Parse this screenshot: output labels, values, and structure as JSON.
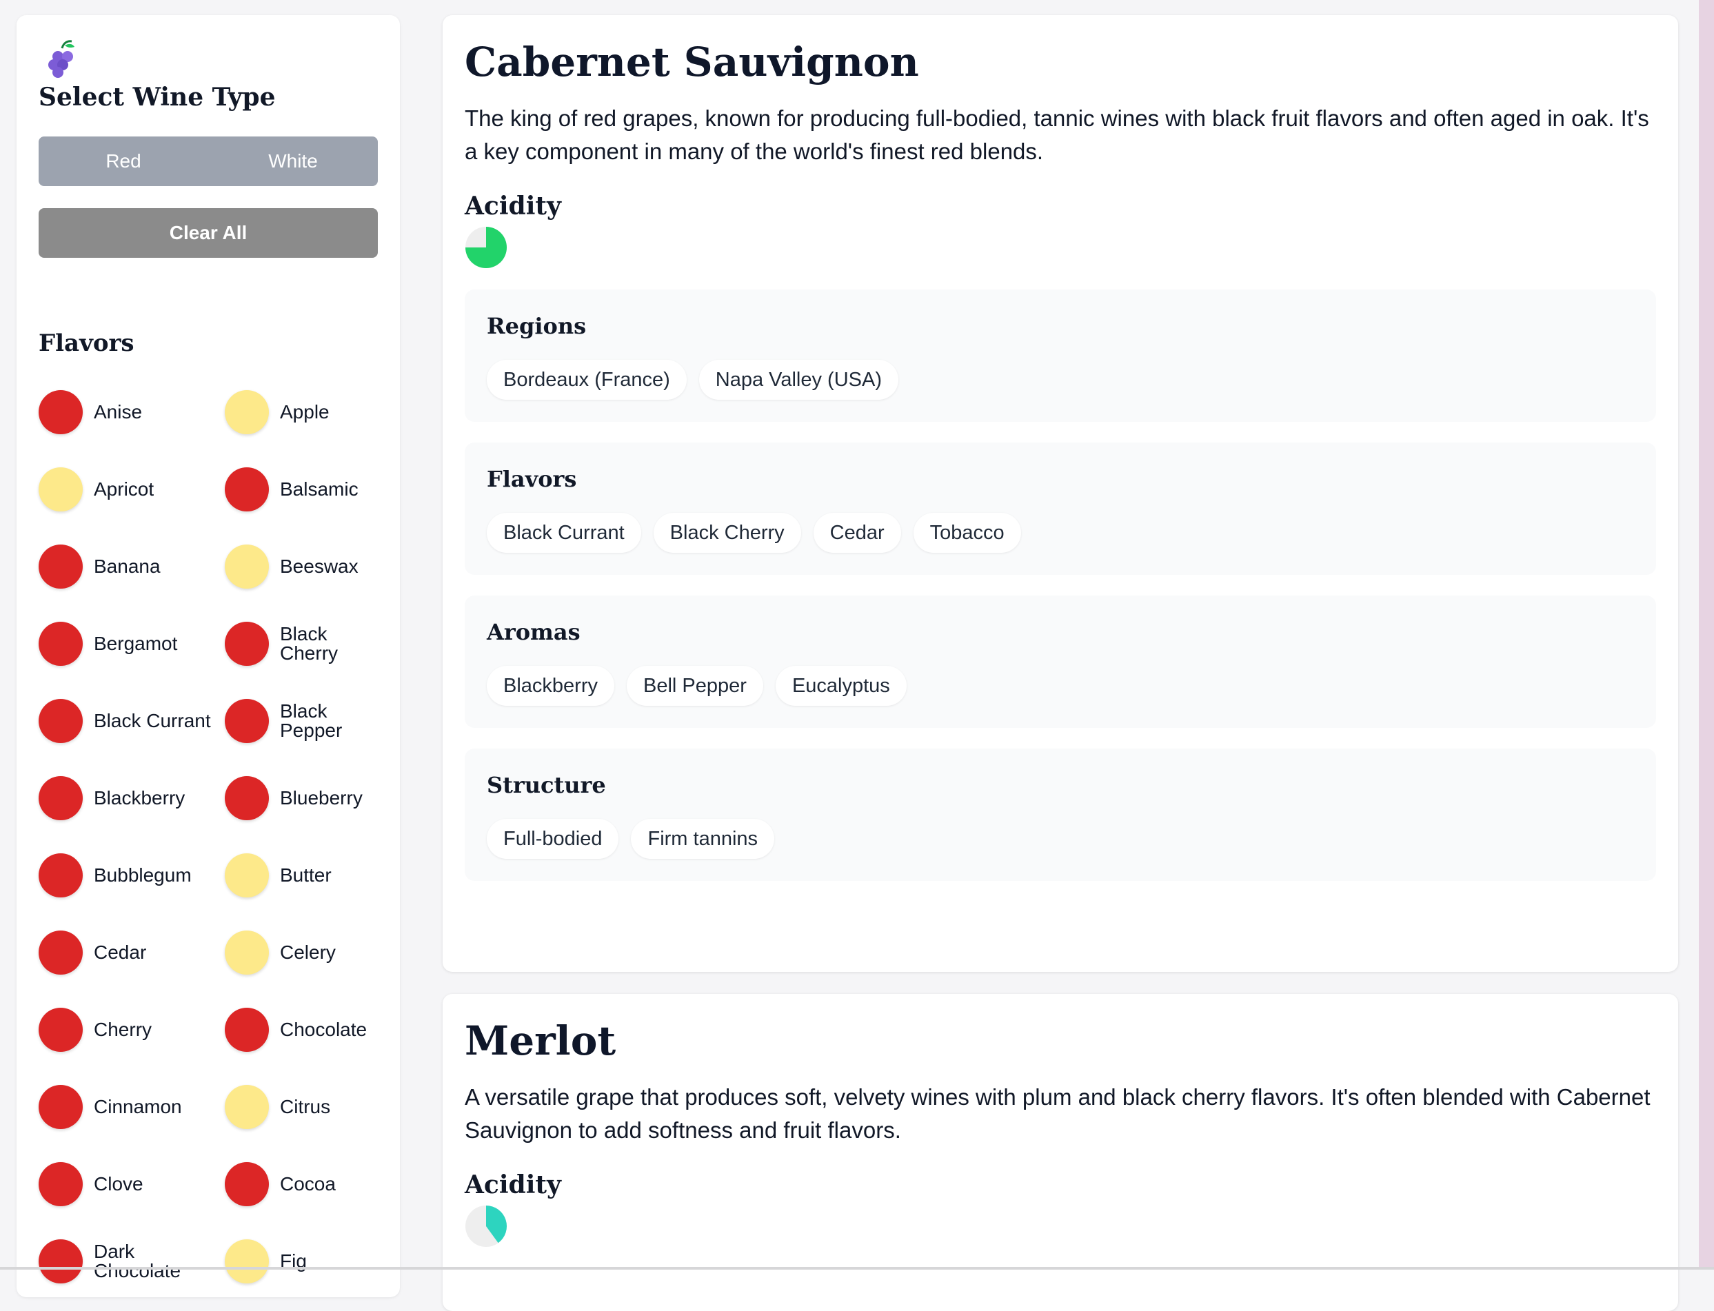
{
  "sidebar": {
    "title": "Select Wine Type",
    "type_options": [
      "Red",
      "White"
    ],
    "clear_label": "Clear All",
    "flavors_title": "Flavors",
    "flavors": [
      {
        "label": "Anise",
        "color": "#dc2626"
      },
      {
        "label": "Apple",
        "color": "#fde98a"
      },
      {
        "label": "Apricot",
        "color": "#fde98a"
      },
      {
        "label": "Balsamic",
        "color": "#dc2626"
      },
      {
        "label": "Banana",
        "color": "#dc2626"
      },
      {
        "label": "Beeswax",
        "color": "#fde98a"
      },
      {
        "label": "Bergamot",
        "color": "#dc2626"
      },
      {
        "label": "Black Cherry",
        "color": "#dc2626"
      },
      {
        "label": "Black Currant",
        "color": "#dc2626"
      },
      {
        "label": "Black Pepper",
        "color": "#dc2626"
      },
      {
        "label": "Blackberry",
        "color": "#dc2626"
      },
      {
        "label": "Blueberry",
        "color": "#dc2626"
      },
      {
        "label": "Bubblegum",
        "color": "#dc2626"
      },
      {
        "label": "Butter",
        "color": "#fde98a"
      },
      {
        "label": "Cedar",
        "color": "#dc2626"
      },
      {
        "label": "Celery",
        "color": "#fde98a"
      },
      {
        "label": "Cherry",
        "color": "#dc2626"
      },
      {
        "label": "Chocolate",
        "color": "#dc2626"
      },
      {
        "label": "Cinnamon",
        "color": "#dc2626"
      },
      {
        "label": "Citrus",
        "color": "#fde98a"
      },
      {
        "label": "Clove",
        "color": "#dc2626"
      },
      {
        "label": "Cocoa",
        "color": "#dc2626"
      },
      {
        "label": "Dark Chocolate",
        "color": "#dc2626"
      },
      {
        "label": "Fig",
        "color": "#fde98a"
      }
    ]
  },
  "wines": [
    {
      "name": "Cabernet Sauvignon",
      "description": "The king of red grapes, known for producing full-bodied, tannic wines with black fruit flavors and often aged in oak. It's a key component in many of the world's finest red blends.",
      "acidity_label": "Acidity",
      "acidity_level": 0.75,
      "acidity_color": "#22d36a",
      "sections": [
        {
          "title": "Regions",
          "chips": [
            "Bordeaux (France)",
            "Napa Valley (USA)"
          ]
        },
        {
          "title": "Flavors",
          "chips": [
            "Black Currant",
            "Black Cherry",
            "Cedar",
            "Tobacco"
          ]
        },
        {
          "title": "Aromas",
          "chips": [
            "Blackberry",
            "Bell Pepper",
            "Eucalyptus"
          ]
        },
        {
          "title": "Structure",
          "chips": [
            "Full-bodied",
            "Firm tannins"
          ]
        }
      ]
    },
    {
      "name": "Merlot",
      "description": "A versatile grape that produces soft, velvety wines with plum and black cherry flavors. It's often blended with Cabernet Sauvignon to add softness and fruit flavors.",
      "acidity_label": "Acidity",
      "acidity_level": 0.4,
      "acidity_color": "#2dd4bf",
      "sections": []
    }
  ],
  "icons": {
    "logo": "grapes-icon"
  }
}
